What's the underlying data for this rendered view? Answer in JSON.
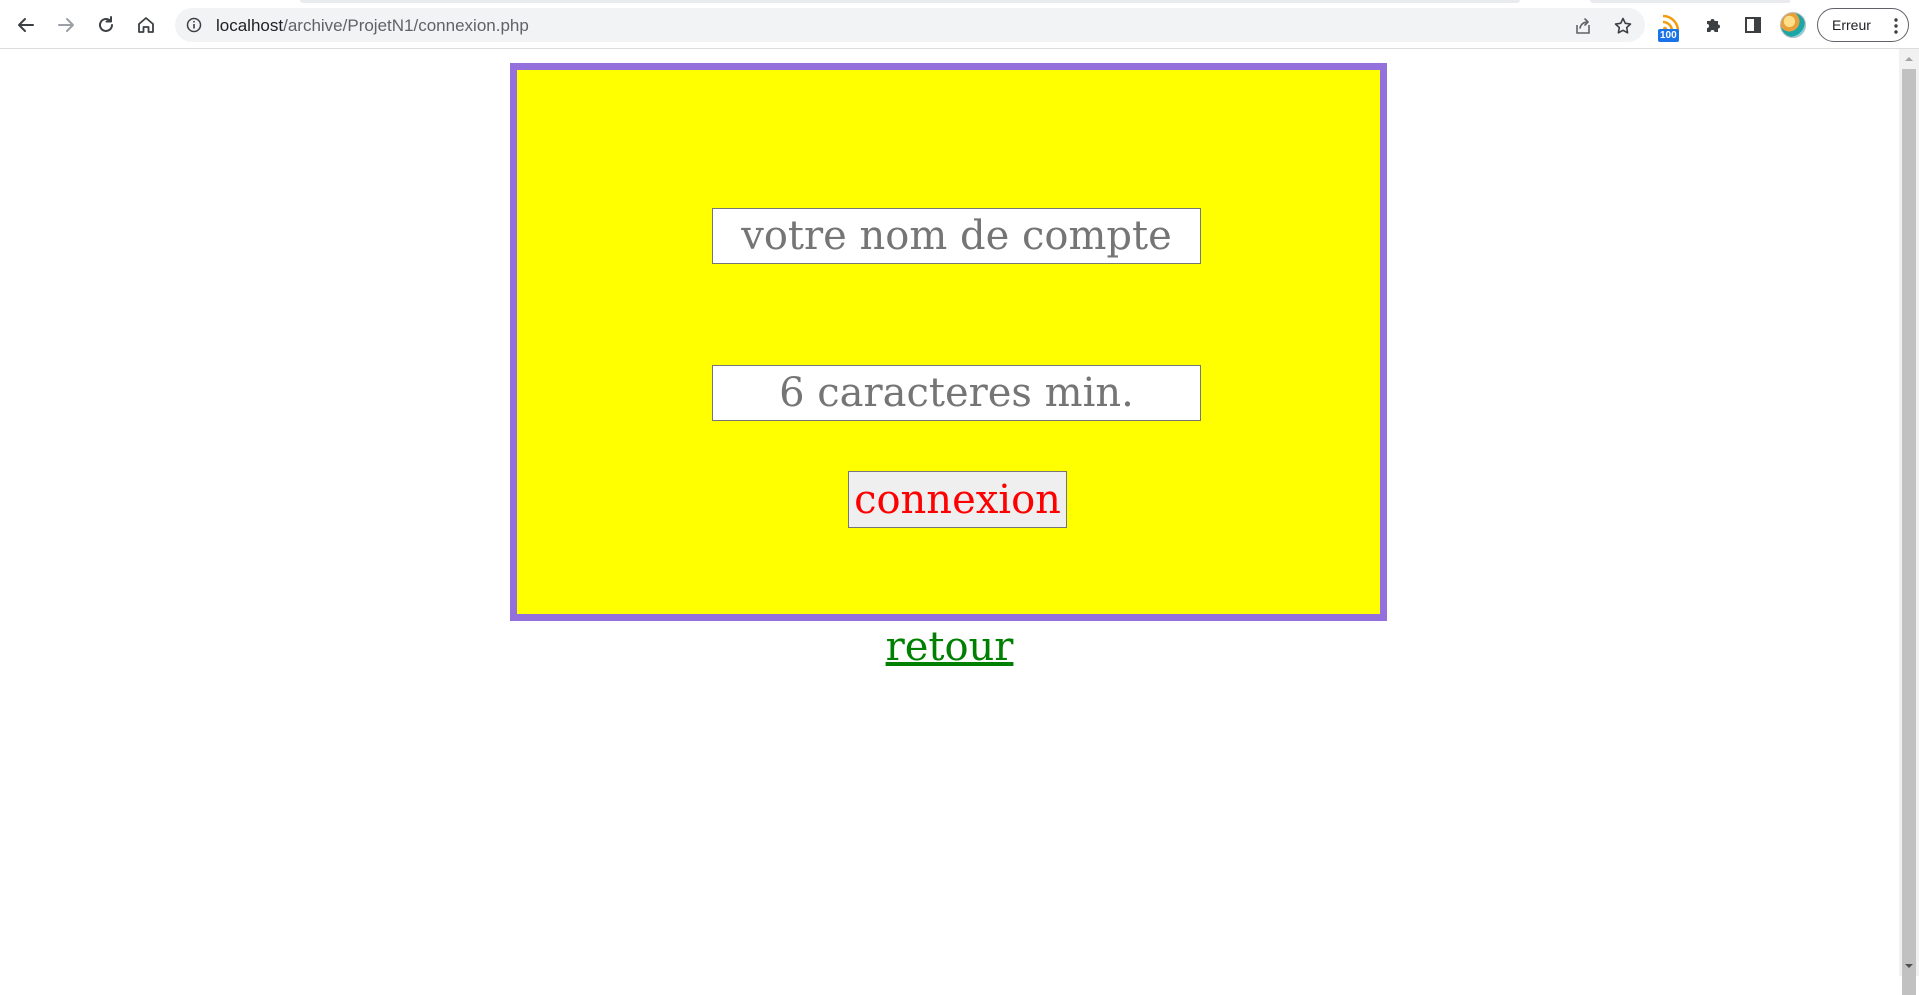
{
  "browser": {
    "url_host": "localhost",
    "url_path": "/archive/ProjetN1/connexion.php",
    "extension_badge": "100",
    "profile_label": "Erreur",
    "icons": {
      "back": "back-arrow-icon",
      "forward": "forward-arrow-icon",
      "reload": "reload-icon",
      "home": "home-icon",
      "site_info": "info-icon",
      "share": "share-icon",
      "bookmark": "star-icon",
      "rss_extension": "rss-icon",
      "extensions": "puzzle-icon",
      "side_panel": "side-panel-icon",
      "menu": "kebab-menu-icon"
    }
  },
  "form": {
    "username_placeholder": "votre nom de compte",
    "password_placeholder": "6 caracteres min.",
    "submit_label": "connexion"
  },
  "back_link": {
    "label": "retour"
  },
  "colors": {
    "box_background": "#ffff00",
    "box_border": "#9370db",
    "submit_text": "#ff0000",
    "link": "#008000",
    "placeholder": "#757575"
  }
}
